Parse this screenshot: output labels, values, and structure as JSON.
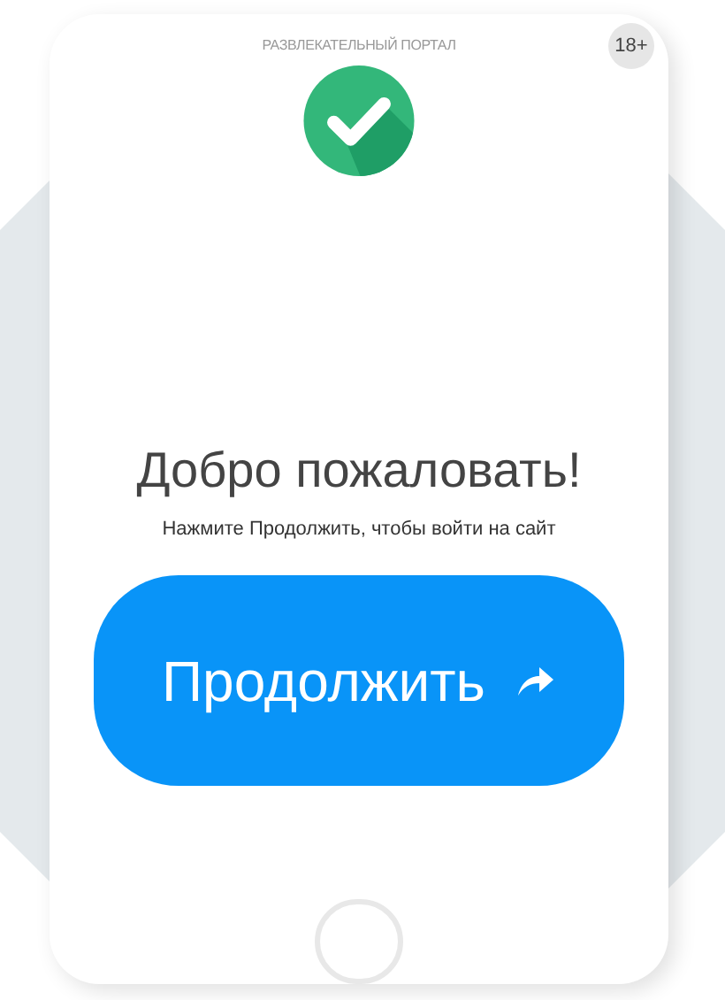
{
  "header": {
    "portal_name": "РАЗВЛЕКАТЕЛЬНЫЙ ПОРТАЛ",
    "age_badge": "18+"
  },
  "welcome": {
    "title": "Добро пожаловать!",
    "subtitle": "Нажмите Продолжить, чтобы войти на сайт"
  },
  "continue_button": {
    "label": "Продолжить"
  }
}
